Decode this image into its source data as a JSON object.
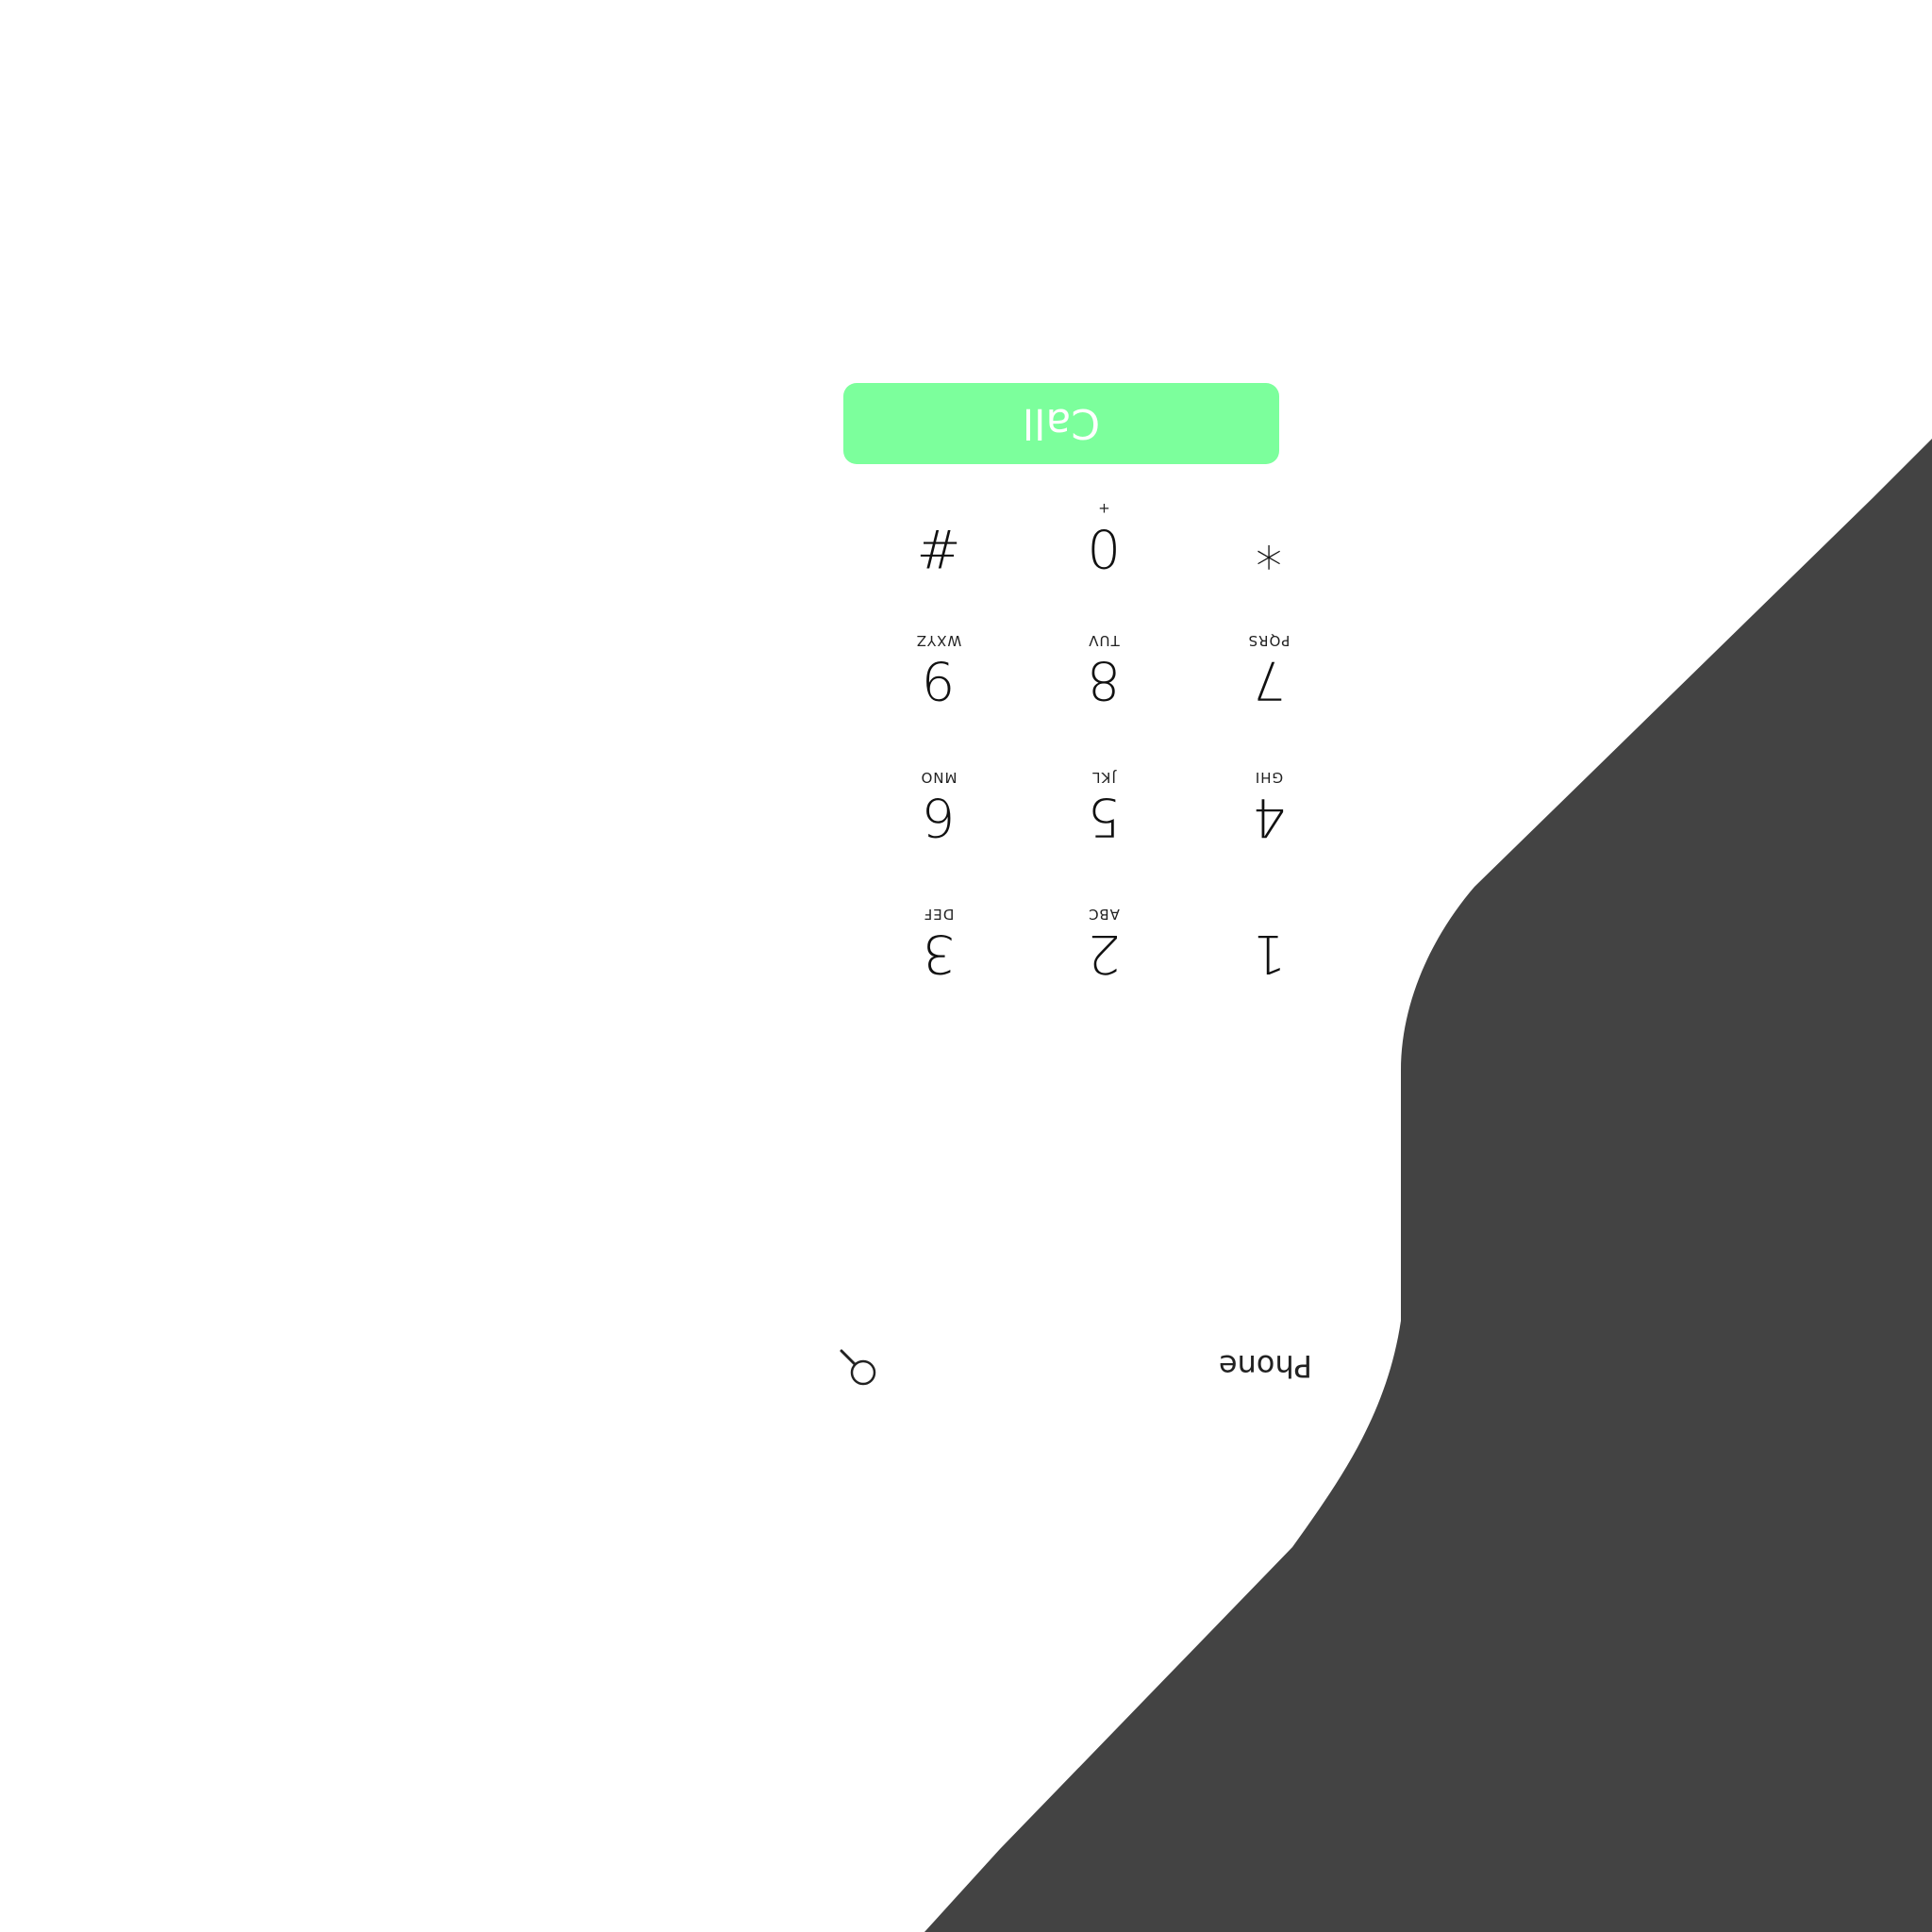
{
  "header": {
    "title": "Phone"
  },
  "icons": {
    "search": "search-icon"
  },
  "keypad": {
    "keys": [
      {
        "digit": "1",
        "letters": ""
      },
      {
        "digit": "2",
        "letters": "ABC"
      },
      {
        "digit": "3",
        "letters": "DEF"
      },
      {
        "digit": "4",
        "letters": "GHI"
      },
      {
        "digit": "5",
        "letters": "JKL"
      },
      {
        "digit": "6",
        "letters": "MNO"
      },
      {
        "digit": "7",
        "letters": "PQRS"
      },
      {
        "digit": "8",
        "letters": "TUV"
      },
      {
        "digit": "9",
        "letters": "WXYZ"
      },
      {
        "digit": "*",
        "letters": ""
      },
      {
        "digit": "0",
        "letters": "+"
      },
      {
        "digit": "#",
        "letters": ""
      }
    ]
  },
  "call_button": {
    "label": "Call",
    "color": "#7cff9c"
  },
  "colors": {
    "hand": "#434343",
    "background": "#ffffff"
  }
}
